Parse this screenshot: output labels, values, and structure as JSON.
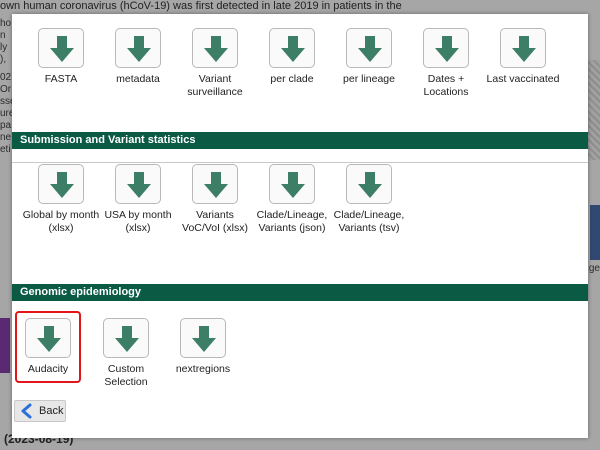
{
  "background": {
    "intro_text": "own human coronavirus (hCoV-19) was first detected in late 2019 in patients in the",
    "left_snippets": [
      "ho",
      "n",
      "ly",
      "),",
      "02",
      "Or",
      "sse",
      "ure",
      "pa",
      "ne",
      "eti"
    ],
    "footer": "(2023-08-19)",
    "right_snippet": "ge"
  },
  "sections": [
    {
      "header": "",
      "items": [
        {
          "label": "FASTA",
          "icon": "download-arrow-icon"
        },
        {
          "label": "metadata",
          "icon": "download-arrow-icon"
        },
        {
          "label": "Variant surveillance",
          "icon": "download-arrow-icon"
        },
        {
          "label": "per clade",
          "icon": "download-arrow-icon"
        },
        {
          "label": "per lineage",
          "icon": "download-arrow-icon"
        },
        {
          "label": "Dates + Locations",
          "icon": "download-arrow-icon"
        },
        {
          "label": "Last vaccinated",
          "icon": "download-arrow-icon"
        }
      ]
    },
    {
      "header": "Submission and Variant statistics",
      "items": [
        {
          "label": "Global by month (xlsx)",
          "icon": "download-arrow-icon"
        },
        {
          "label": "USA by month (xlsx)",
          "icon": "download-arrow-icon"
        },
        {
          "label": "Variants VoC/VoI (xlsx)",
          "icon": "download-arrow-icon"
        },
        {
          "label": "Clade/Lineage, Variants (json)",
          "icon": "download-arrow-icon"
        },
        {
          "label": "Clade/Lineage, Variants (tsv)",
          "icon": "download-arrow-icon"
        }
      ]
    },
    {
      "header": "Genomic epidemiology",
      "items": [
        {
          "label": "Audacity",
          "icon": "download-arrow-icon"
        },
        {
          "label": "Custom Selection",
          "icon": "download-arrow-icon"
        },
        {
          "label": "nextregions",
          "icon": "download-arrow-icon"
        }
      ]
    }
  ],
  "back_button": {
    "label": "Back",
    "icon": "chevron-left-icon"
  },
  "colors": {
    "section_header": "#0b5a44",
    "arrow": "#3d7f66",
    "highlight": "#e3141a"
  }
}
